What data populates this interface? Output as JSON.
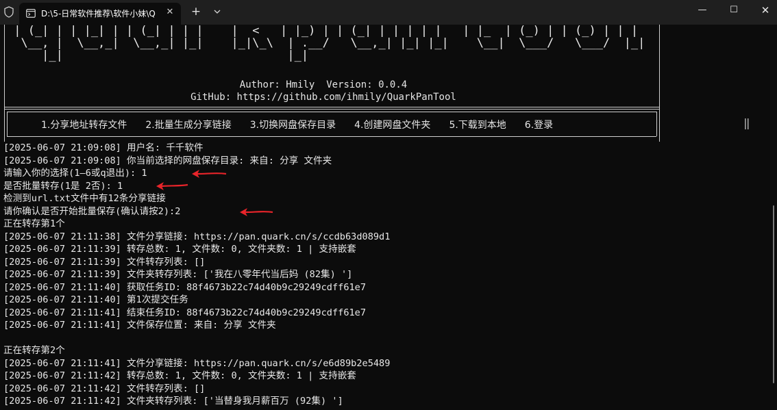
{
  "window": {
    "tab_title": "D:\\5-日常软件推荐\\软件小妹\\Q",
    "tab_close": "✕",
    "new_tab": "+",
    "minimize": "—",
    "maximize": "☐",
    "close": "✕"
  },
  "banner": {
    "ascii_art": " | (_| | | |_| | | (_| | | |    |  <   | |_) | | (_| | | | | |   | |_  | (_) | | (_) | | |\n  \\__, |  \\__,_|  \\__,_| |_|    |_|\\_\\  | .__/   \\__,_| |_| |_|    \\__|  \\___/   \\___/  |_|\n     |_|                                |_|",
    "author_line": "Author: Hmily  Version: 0.0.4",
    "github_line": "GitHub: https://github.com/ihmily/QuarkPanTool",
    "menu_items": [
      "1.分享地址转存文件",
      "2.批量生成分享链接",
      "3.切换网盘保存目录",
      "4.创建网盘文件夹",
      "5.下载到本地",
      "6.登录"
    ],
    "right_edge_mark": "‖"
  },
  "log_lines": [
    "[2025-06-07 21:09:08] 用户名: 千千软件",
    "[2025-06-07 21:09:08] 你当前选择的网盘保存目录: 来自: 分享 文件夹",
    "请输入你的选择(1—6或q退出): 1",
    "是否批量转存(1是 2否): 1",
    "检测到url.txt文件中有12条分享链接",
    "请你确认是否开始批量保存(确认请按2):2",
    "正在转存第1个",
    "[2025-06-07 21:11:38] 文件分享链接: https://pan.quark.cn/s/ccdb63d089d1",
    "[2025-06-07 21:11:39] 转存总数: 1, 文件数: 0, 文件夹数: 1 | 支持嵌套",
    "[2025-06-07 21:11:39] 文件转存列表: []",
    "[2025-06-07 21:11:39] 文件夹转存列表: ['我在八零年代当后妈 (82集) ']",
    "[2025-06-07 21:11:40] 获取任务ID: 88f4673b22c74d40b9c29249cdff61e7",
    "[2025-06-07 21:11:40] 第1次提交任务",
    "[2025-06-07 21:11:41] 结束任务ID: 88f4673b22c74d40b9c29249cdff61e7",
    "[2025-06-07 21:11:41] 文件保存位置: 来自: 分享 文件夹",
    "",
    "正在转存第2个",
    "[2025-06-07 21:11:41] 文件分享链接: https://pan.quark.cn/s/e6d89b2e5489",
    "[2025-06-07 21:11:42] 转存总数: 1, 文件数: 0, 文件夹数: 1 | 支持嵌套",
    "[2025-06-07 21:11:42] 文件转存列表: []",
    "[2025-06-07 21:11:42] 文件夹转存列表: ['当替身我月薪百万 (92集) ']"
  ],
  "colors": {
    "background": "#0c0c0c",
    "tab_bar": "#1f1f1f",
    "text": "#e8e8e8",
    "annotation_arrow": "#e8242a"
  },
  "icons": [
    "shield-icon",
    "terminal-icon",
    "close-icon",
    "plus-icon",
    "chevron-down-icon",
    "minimize-icon",
    "maximize-icon",
    "close-icon",
    "red-arrow-icon"
  ]
}
